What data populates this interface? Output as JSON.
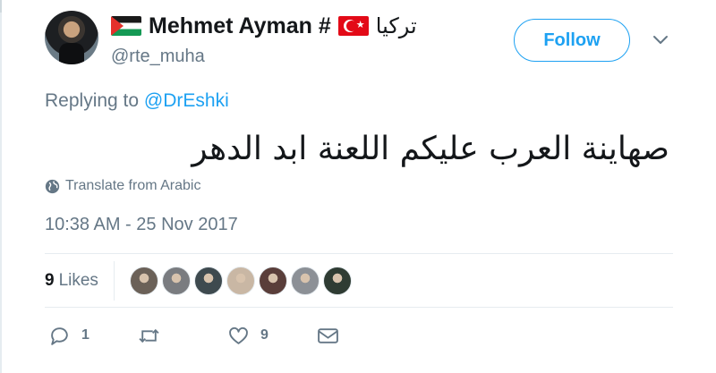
{
  "user": {
    "display_name": "Mehmet Ayman #",
    "arabic_name": "تركيا",
    "handle": "@rte_muha",
    "flags": [
      "palestine-flag-icon",
      "turkey-flag-icon"
    ]
  },
  "follow_button": {
    "label": "Follow"
  },
  "reply": {
    "prefix": "Replying to",
    "target": "@DrEshki"
  },
  "tweet": {
    "text": "صهاينة العرب عليكم اللعنة ابد الدهر"
  },
  "translate": {
    "label": "Translate from Arabic",
    "icon": "globe-icon"
  },
  "timestamp": "10:38 AM - 25 Nov 2017",
  "likes": {
    "count": "9",
    "label": "Likes",
    "avatars": [
      "#6b6158",
      "#7a7c80",
      "#3e4a4f",
      "#c9b7a4",
      "#5a3e3a",
      "#8c9096",
      "#2f3c33"
    ]
  },
  "actions": {
    "reply_count": "1",
    "retweet_count": "",
    "like_count": "9"
  },
  "colors": {
    "accent": "#1da1f2",
    "secondary_text": "#657786",
    "primary_text": "#14171a",
    "divider": "#e6ecf0"
  }
}
